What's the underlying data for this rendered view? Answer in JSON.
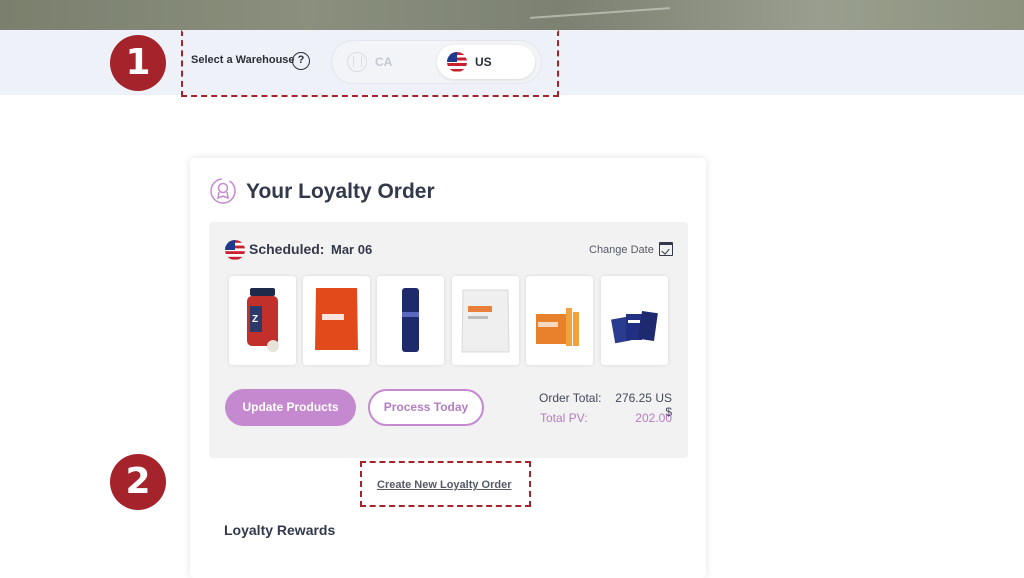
{
  "warehouse": {
    "label": "Select a Warehouse",
    "help_glyph": "?",
    "options": [
      {
        "code": "CA",
        "selected": false
      },
      {
        "code": "US",
        "selected": true
      }
    ]
  },
  "annotations": {
    "step1": "1",
    "step2": "2",
    "highlight_color": "#a5232a"
  },
  "loyalty": {
    "title": "Your Loyalty Order",
    "scheduled_label": "Scheduled:",
    "scheduled_date": "Mar 06",
    "change_date": "Change Date",
    "products": [
      {
        "icon": "sleep-supplement-bottle"
      },
      {
        "icon": "orange-supplement-pouch"
      },
      {
        "icon": "navy-tube"
      },
      {
        "icon": "white-supplement-pouch"
      },
      {
        "icon": "orange-box-with-sticks"
      },
      {
        "icon": "blue-sachet-packets"
      }
    ],
    "update_button": "Update Products",
    "process_button": "Process Today",
    "order_total_label": "Order Total:",
    "order_total_value": "276.25 US $",
    "total_pv_label": "Total PV:",
    "total_pv_value": "202.00",
    "create_link": "Create New Loyalty Order",
    "rewards_title": "Loyalty Rewards"
  },
  "colors": {
    "accent_purple": "#c589cf",
    "text_dark": "#33394a"
  }
}
